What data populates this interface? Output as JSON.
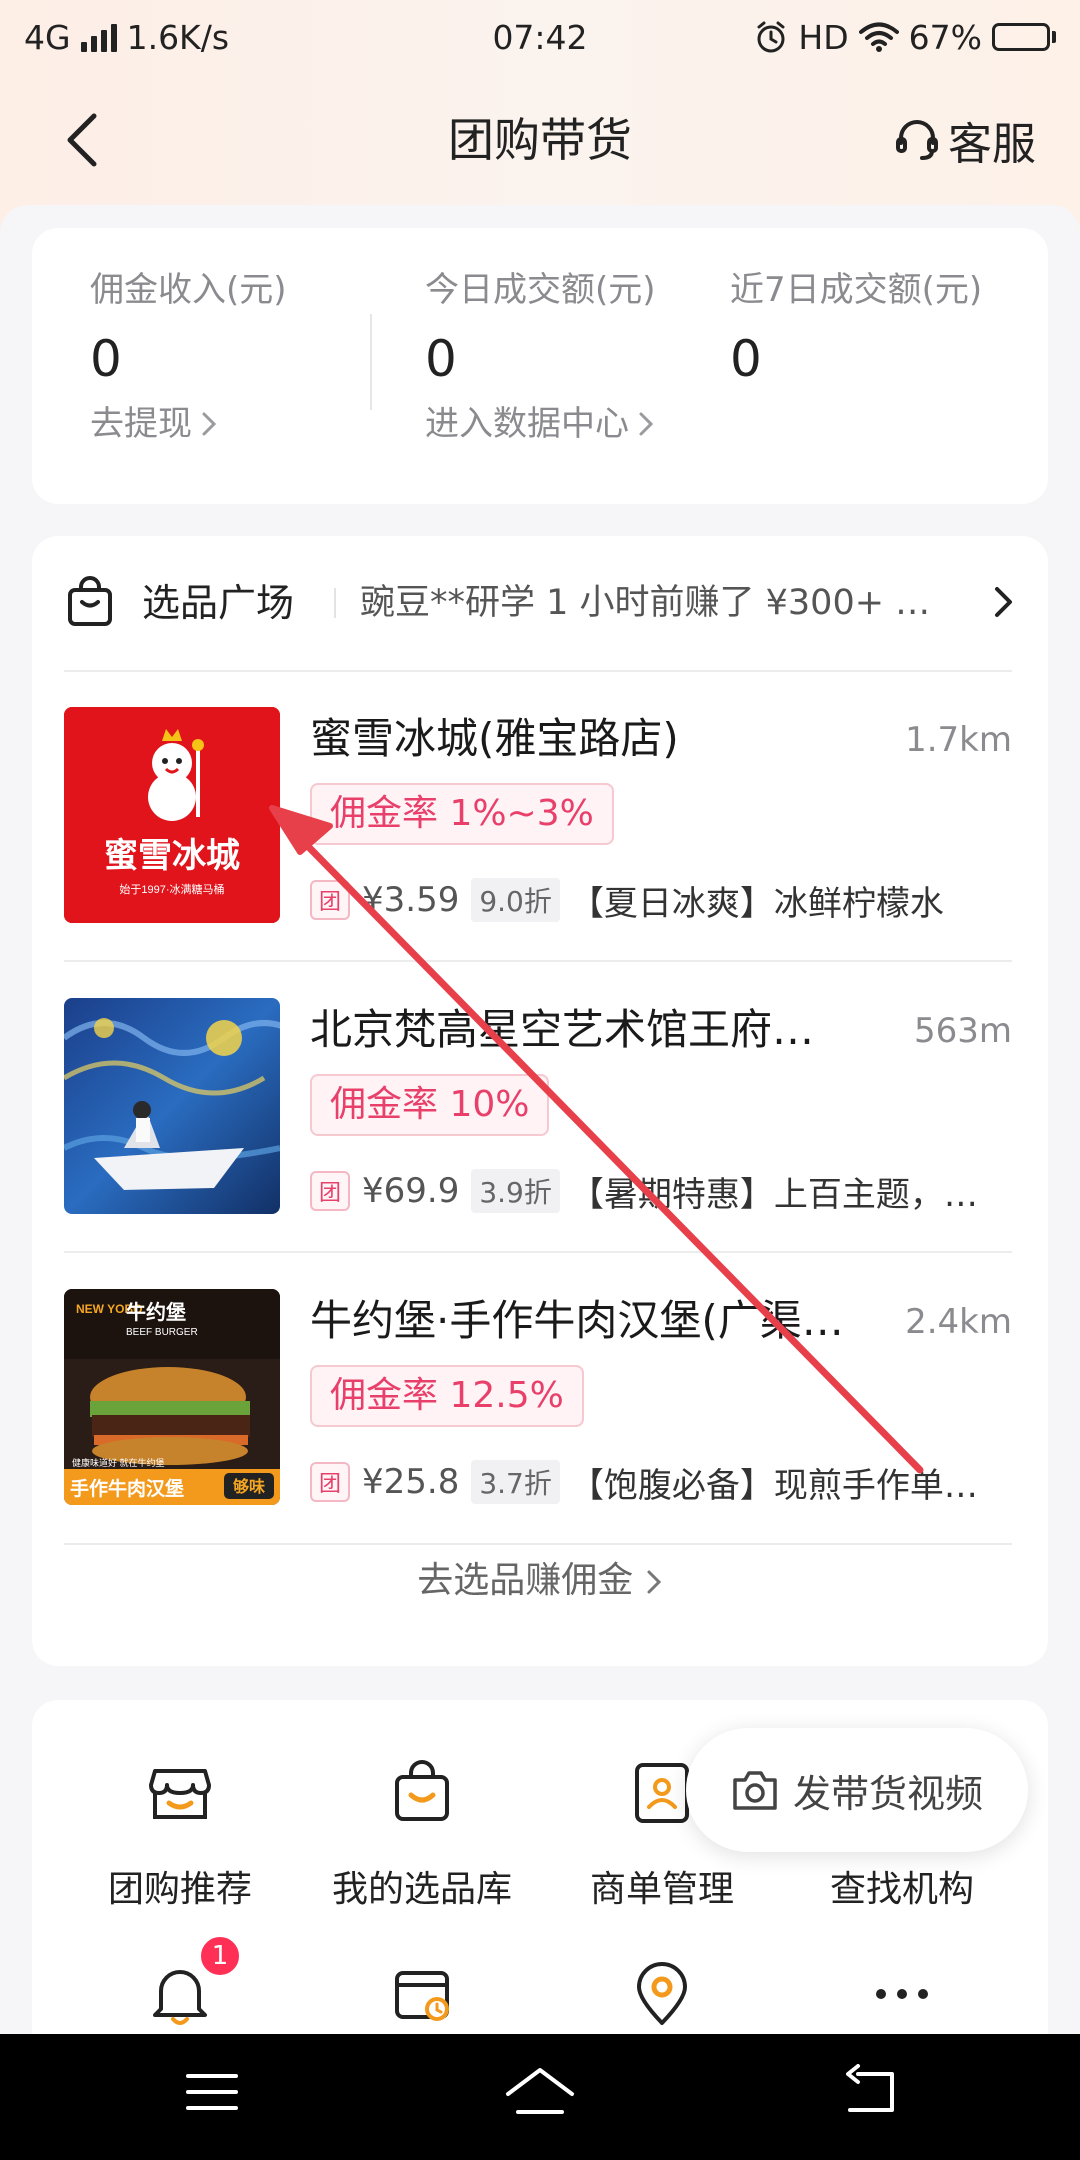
{
  "status_bar": {
    "network": "4G",
    "speed": "1.6K/s",
    "time": "07:42",
    "hd": "HD",
    "battery": "67%",
    "battery_level": 0.67
  },
  "header": {
    "title": "团购带货",
    "service_label": "客服"
  },
  "stats": [
    {
      "label": "佣金收入(元)",
      "value": "0",
      "link": "去提现"
    },
    {
      "label": "今日成交额(元)",
      "value": "0",
      "link": "进入数据中心"
    },
    {
      "label": "近7日成交额(元)",
      "value": "0"
    }
  ],
  "plaza": {
    "title": "选品广场",
    "ticker": "豌豆**研学 1 小时前赚了 ¥300+ …",
    "products": [
      {
        "name": "蜜雪冰城(雅宝路店)",
        "distance": "1.7km",
        "commission": "佣金率 1%~3%",
        "tag": "团",
        "price": "¥3.59",
        "discount": "9.0折",
        "desc": "【夏日冰爽】冰鲜柠檬水",
        "thumb_text": "蜜雪冰城",
        "thumb_subtext": "始于1997·冰满糖马桶"
      },
      {
        "name": "北京梵高星空艺术馆王府井…",
        "distance": "563m",
        "commission": "佣金率 10%",
        "tag": "团",
        "price": "¥69.9",
        "discount": "3.9折",
        "desc": "【暑期特惠】上百主题，…"
      },
      {
        "name": "牛约堡·手作牛肉汉堡(广渠…",
        "distance": "2.4km",
        "commission": "佣金率 12.5%",
        "tag": "团",
        "price": "¥25.8",
        "discount": "3.7折",
        "desc": "【饱腹必备】现煎手作单…",
        "thumb_brand": "牛约堡",
        "thumb_brand_en": "BEEF BURGER",
        "thumb_new": "NEW YOBO",
        "thumb_slogan": "手作牛肉汉堡",
        "thumb_slogan_small": "健康味道好  就在牛约堡",
        "thumb_corner": "够味"
      }
    ],
    "more_link": "去选品赚佣金"
  },
  "tools": {
    "row1": [
      {
        "label": "团购推荐",
        "icon": "store-icon"
      },
      {
        "label": "我的选品库",
        "icon": "shopping-bag-icon"
      },
      {
        "label": "商单管理",
        "icon": "contact-card-icon"
      },
      {
        "label": "查找机构",
        "icon": "search-org-icon"
      }
    ],
    "row2": [
      {
        "icon": "bell-icon",
        "badge": "1"
      },
      {
        "icon": "wallet-icon"
      },
      {
        "icon": "location-icon"
      },
      {
        "icon": "more-icon"
      }
    ],
    "float_button": "发带货视频"
  },
  "colors": {
    "accent": "#e8406a",
    "annotation_arrow": "#e8404a"
  }
}
